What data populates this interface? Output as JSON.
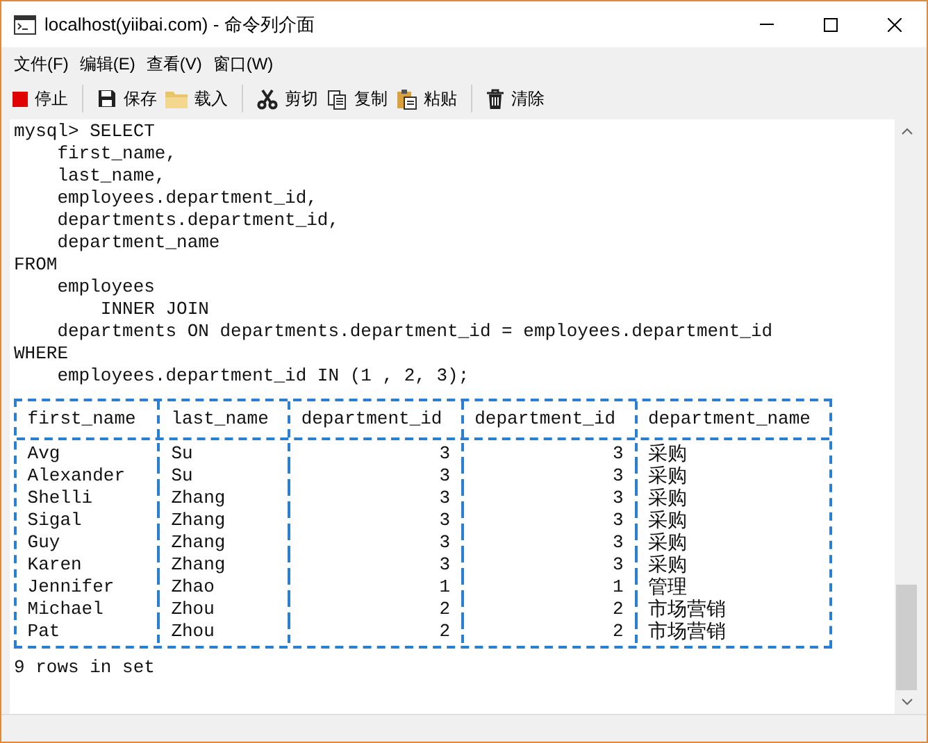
{
  "window": {
    "title": "localhost(yiibai.com) - 命令列介面"
  },
  "menu": [
    "文件(F)",
    "编辑(E)",
    "查看(V)",
    "窗口(W)"
  ],
  "toolbar": [
    {
      "kind": "stop",
      "label": "停止"
    },
    {
      "kind": "sep"
    },
    {
      "kind": "save",
      "label": "保存"
    },
    {
      "kind": "load",
      "label": "载入"
    },
    {
      "kind": "sep"
    },
    {
      "kind": "cut",
      "label": "剪切"
    },
    {
      "kind": "copy",
      "label": "复制"
    },
    {
      "kind": "paste",
      "label": "粘贴"
    },
    {
      "kind": "sep"
    },
    {
      "kind": "clear",
      "label": "清除"
    }
  ],
  "console_lines": [
    "mysql> SELECT",
    "    first_name,",
    "    last_name,",
    "    employees.department_id,",
    "    departments.department_id,",
    "    department_name",
    "FROM",
    "    employees",
    "        INNER JOIN",
    "    departments ON departments.department_id = employees.department_id",
    "WHERE",
    "    employees.department_id IN (1 , 2, 3);"
  ],
  "table": {
    "columns": [
      {
        "label": "first_name",
        "kind": "text"
      },
      {
        "label": "last_name",
        "kind": "text"
      },
      {
        "label": "department_id",
        "kind": "number"
      },
      {
        "label": "department_id",
        "kind": "number"
      },
      {
        "label": "department_name",
        "kind": "text"
      }
    ],
    "rows": [
      [
        "Avg",
        "Su",
        "3",
        "3",
        "采购"
      ],
      [
        "Alexander",
        "Su",
        "3",
        "3",
        "采购"
      ],
      [
        "Shelli",
        "Zhang",
        "3",
        "3",
        "采购"
      ],
      [
        "Sigal",
        "Zhang",
        "3",
        "3",
        "采购"
      ],
      [
        "Guy",
        "Zhang",
        "3",
        "3",
        "采购"
      ],
      [
        "Karen",
        "Zhang",
        "3",
        "3",
        "采购"
      ],
      [
        "Jennifer",
        "Zhao",
        "1",
        "1",
        "管理"
      ],
      [
        "Michael",
        "Zhou",
        "2",
        "2",
        "市场营销"
      ],
      [
        "Pat",
        "Zhou",
        "2",
        "2",
        "市场营销"
      ]
    ]
  },
  "result_summary": "9 rows in set"
}
